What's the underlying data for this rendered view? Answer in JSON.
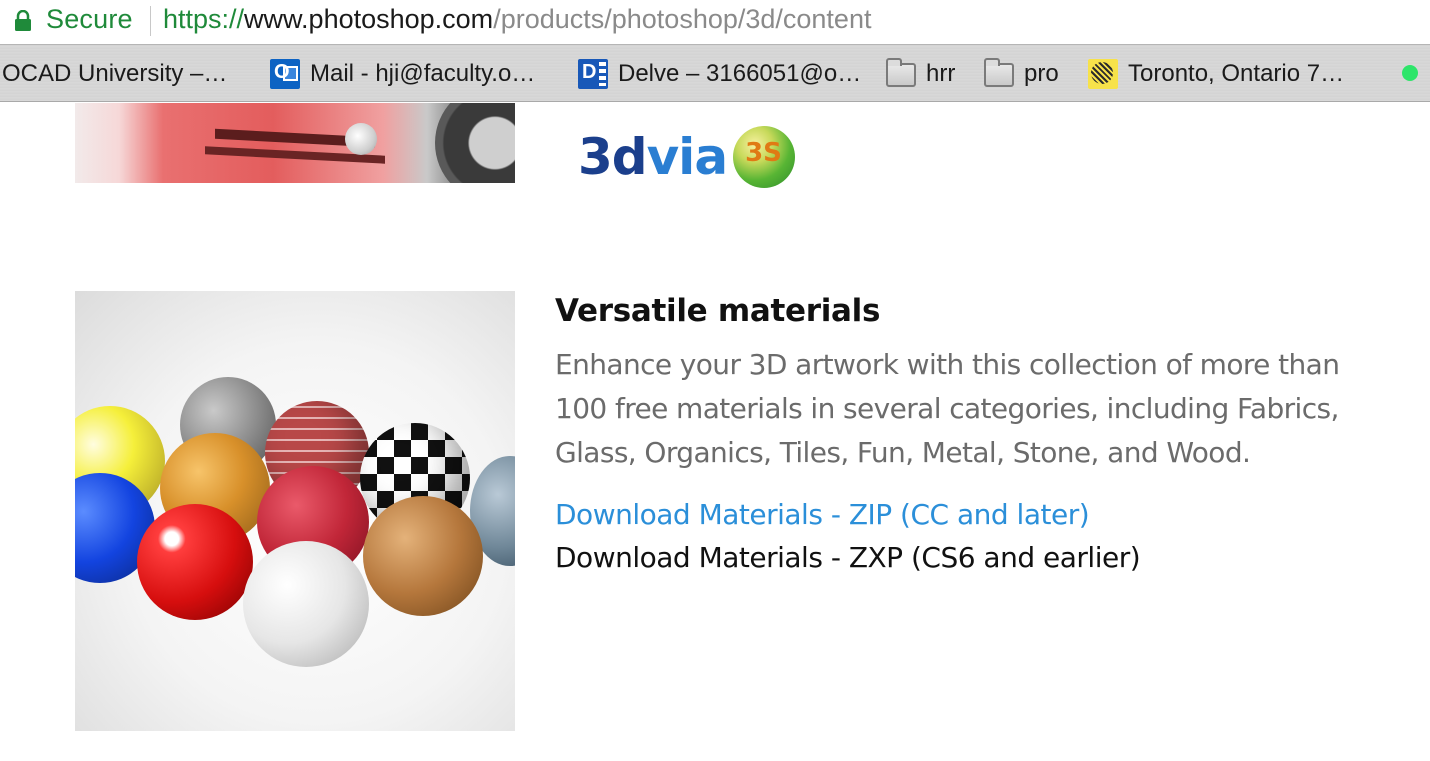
{
  "browser": {
    "secure_label": "Secure",
    "url": {
      "scheme": "https://",
      "host": "www.photoshop.com",
      "path": "/products/photoshop/3d/content"
    },
    "bookmarks": [
      {
        "label": "OCAD University –…",
        "icon": "none"
      },
      {
        "label": "Mail - hji@faculty.o…",
        "icon": "outlook-icon"
      },
      {
        "label": "Delve – 3166051@o…",
        "icon": "delve-icon"
      },
      {
        "label": "hrr",
        "icon": "folder-icon"
      },
      {
        "label": "pro",
        "icon": "folder-icon"
      },
      {
        "label": "Toronto, Ontario 7…",
        "icon": "weather-icon"
      }
    ],
    "status_dot_color": "#2ee56a"
  },
  "content": {
    "logo": {
      "part1": "3d",
      "part2": "via"
    },
    "section": {
      "title": "Versatile materials",
      "description": "Enhance your 3D artwork with this collection of more than 100 free materials in several categories, including Fabrics, Glass, Organics, Tiles, Fun, Metal, Stone, and Wood.",
      "link_zip": "Download Materials - ZIP (CC and later)",
      "link_zxp": "Download Materials - ZXP (CS6 and earlier)"
    }
  },
  "colors": {
    "secure_green": "#1f8a3a",
    "link_blue": "#2b8fd9",
    "description_gray": "#6b6b6b"
  }
}
